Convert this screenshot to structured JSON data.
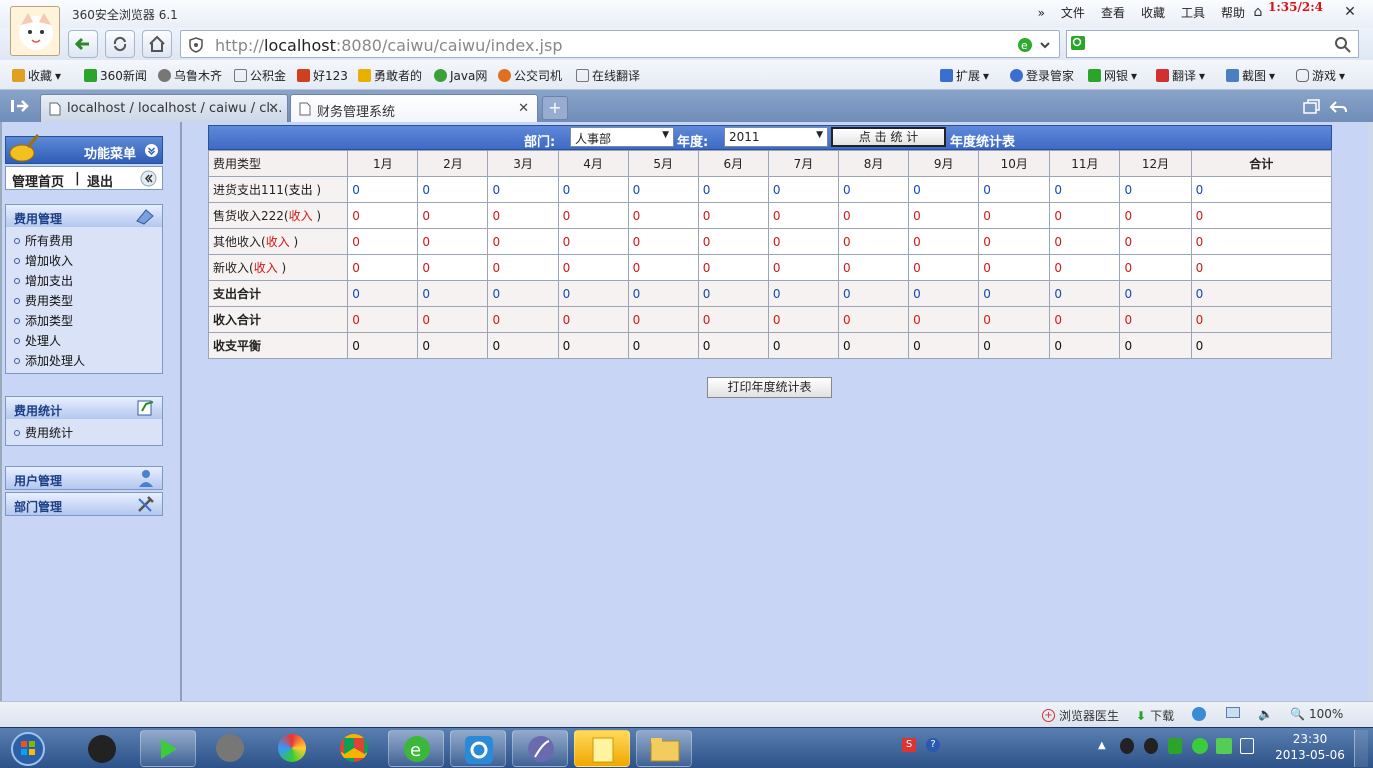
{
  "window": {
    "app_name": "360安全浏览器 6.1",
    "clock_overlay": "1:35/2:4"
  },
  "menu": [
    "文件",
    "查看",
    "收藏",
    "工具",
    "帮助"
  ],
  "menu_more": "»",
  "address": {
    "url_prefix": "http://",
    "url_host": "localhost",
    "url_rest": ":8080/caiwu/caiwu/index.jsp"
  },
  "bookmarks": [
    {
      "label": "收藏",
      "color": "#e0a020"
    },
    {
      "label": "360新闻",
      "color": "#2aa52a"
    },
    {
      "label": "乌鲁木齐",
      "color": "#888888"
    },
    {
      "label": "公积金",
      "color": "#ffffff"
    },
    {
      "label": "好123",
      "color": "#d04020"
    },
    {
      "label": "勇敢者的",
      "color": "#e8b000"
    },
    {
      "label": "Java网",
      "color": "#3aa03a"
    },
    {
      "label": "公交司机",
      "color": "#e07020"
    },
    {
      "label": "在线翻译",
      "color": "#ffffff"
    }
  ],
  "bookmarks_right": [
    "扩展",
    "登录管家",
    "网银",
    "翻译",
    "截图",
    "游戏"
  ],
  "tabs": [
    {
      "label": "localhost / localhost / caiwu / cl...",
      "active": false
    },
    {
      "label": "财务管理系统",
      "active": true
    }
  ],
  "sidebar": {
    "menu_title": "功能菜单",
    "home_label": "管理首页",
    "separator": "|",
    "logout_label": "退出",
    "sections": [
      {
        "title": "费用管理",
        "items": [
          "所有费用",
          "增加收入",
          "增加支出",
          "费用类型",
          "添加类型",
          "处理人",
          "添加处理人"
        ]
      },
      {
        "title": "费用统计",
        "items": [
          "费用统计"
        ]
      },
      {
        "title": "用户管理",
        "items": []
      },
      {
        "title": "部门管理",
        "items": []
      }
    ]
  },
  "filter": {
    "dept_label": "部门:",
    "dept_value": "人事部",
    "year_label": "年度:",
    "year_value": "2011",
    "submit_label": "点 击 统 计",
    "report_title": "年度统计表"
  },
  "table": {
    "headers": [
      "费用类型",
      "1月",
      "2月",
      "3月",
      "4月",
      "5月",
      "6月",
      "7月",
      "8月",
      "9月",
      "10月",
      "11月",
      "12月",
      "合计"
    ],
    "rows": [
      {
        "label": "进货支出111(",
        "tag": "支出",
        "tail": " )",
        "kind": "expense",
        "values": [
          "0",
          "0",
          "0",
          "0",
          "0",
          "0",
          "0",
          "0",
          "0",
          "0",
          "0",
          "0",
          "0"
        ]
      },
      {
        "label": "售货收入222(",
        "tag": "收入",
        "tail": " )",
        "kind": "income",
        "values": [
          "0",
          "0",
          "0",
          "0",
          "0",
          "0",
          "0",
          "0",
          "0",
          "0",
          "0",
          "0",
          "0"
        ]
      },
      {
        "label": "其他收入(",
        "tag": "收入",
        "tail": " )",
        "kind": "income",
        "values": [
          "0",
          "0",
          "0",
          "0",
          "0",
          "0",
          "0",
          "0",
          "0",
          "0",
          "0",
          "0",
          "0"
        ]
      },
      {
        "label": "新收入(",
        "tag": "收入",
        "tail": " )",
        "kind": "income",
        "values": [
          "0",
          "0",
          "0",
          "0",
          "0",
          "0",
          "0",
          "0",
          "0",
          "0",
          "0",
          "0",
          "0"
        ]
      },
      {
        "label": "支出合计",
        "tag": "",
        "tail": "",
        "kind": "expense-sum",
        "values": [
          "0",
          "0",
          "0",
          "0",
          "0",
          "0",
          "0",
          "0",
          "0",
          "0",
          "0",
          "0",
          "0"
        ]
      },
      {
        "label": "收入合计",
        "tag": "",
        "tail": "",
        "kind": "income-sum",
        "values": [
          "0",
          "0",
          "0",
          "0",
          "0",
          "0",
          "0",
          "0",
          "0",
          "0",
          "0",
          "0",
          "0"
        ]
      },
      {
        "label": "收支平衡",
        "tag": "",
        "tail": "",
        "kind": "balance",
        "values": [
          "0",
          "0",
          "0",
          "0",
          "0",
          "0",
          "0",
          "0",
          "0",
          "0",
          "0",
          "0",
          "0"
        ]
      }
    ]
  },
  "print_label": "打印年度统计表",
  "statusbar": {
    "doctor": "浏览器医生",
    "download": "下载",
    "zoom": "100%"
  },
  "taskbar": {
    "time": "23:30",
    "date": "2013-05-06"
  }
}
